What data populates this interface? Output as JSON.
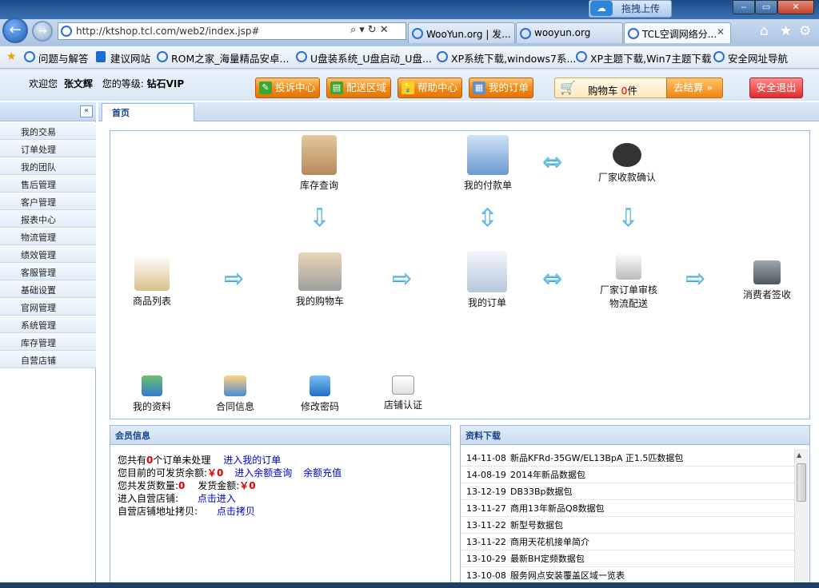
{
  "browser": {
    "upload_label": "拖拽上传",
    "upload_icon": "cloud-icon",
    "address": "http://ktshop.tcl.com/web2/index.jsp#",
    "tabs": [
      {
        "label": "WooYun.org | 发..."
      },
      {
        "label": "wooyun.org"
      },
      {
        "label": "TCL空调网络分...",
        "active": true
      }
    ],
    "favorites": [
      {
        "label": "问题与解答",
        "icon": "star-icon"
      },
      {
        "label": "建议网站",
        "icon": "bing-icon"
      },
      {
        "label": "ROM之家_海量精品安卓...",
        "icon": "ie-icon"
      },
      {
        "label": "U盘装系统_U盘启动_U盘...",
        "icon": "ie-icon"
      },
      {
        "label": "XP系统下载,windows7系...",
        "icon": "ie-icon"
      },
      {
        "label": "XP主题下载,Win7主题下载",
        "icon": "ie-icon"
      },
      {
        "label": "安全网址导航",
        "icon": "ie-icon"
      }
    ]
  },
  "header": {
    "welcome_prefix": "欢迎您",
    "username": "张文辉",
    "level_prefix": "您的等级:",
    "level": "钻石VIP",
    "buttons": [
      {
        "label": "投诉中心"
      },
      {
        "label": "配送区域"
      },
      {
        "label": "帮助中心"
      },
      {
        "label": "我的订单"
      }
    ],
    "cart_label": "购物车",
    "cart_count": "0",
    "cart_unit": "件",
    "checkout_label": "去结算 »",
    "logout_label": "安全退出"
  },
  "sidebar": {
    "collapse_icon": "double-chevron-left-icon",
    "items": [
      "我的交易",
      "订单处理",
      "我的团队",
      "售后管理",
      "客户管理",
      "报表中心",
      "物流管理",
      "绩效管理",
      "客服管理",
      "基础设置",
      "官网管理",
      "系统管理",
      "库存管理",
      "自营店铺"
    ]
  },
  "main": {
    "tab": "首页",
    "flow": {
      "stock": "库存查询",
      "payment": "我的付款单",
      "confirm": "厂家收款确认",
      "products": "商品列表",
      "cart": "我的购物车",
      "orders": "我的订单",
      "audit_1": "厂家订单审核",
      "audit_2": "物流配送",
      "signoff": "消费者签收",
      "profile": "我的资料",
      "contract": "合同信息",
      "password": "修改密码",
      "store_cert": "店铺认证"
    },
    "member": {
      "title": "会员信息",
      "pending_prefix": "您共有",
      "pending_count": "0",
      "pending_suffix": "个订单未处理",
      "pending_link": "进入我的订单",
      "balance_label": "您目前的可发货余额:",
      "balance_value": "￥0",
      "balance_link": "进入余额查询",
      "recharge_link": "余额充值",
      "ship_qty_label": "您共发货数量:",
      "ship_qty_value": "0",
      "ship_amt_label": "发货金额:",
      "ship_amt_value": "￥0",
      "store_label": "进入自营店铺:",
      "store_link": "点击进入",
      "store_addr_label": "自营店铺地址拷贝:",
      "store_addr_link": "点击拷贝"
    },
    "downloads": {
      "title": "资料下载",
      "rows": [
        {
          "date": "14-11-08",
          "name": "新品KFRd-35GW/EL13BpA 正1.5匹数据包"
        },
        {
          "date": "14-08-19",
          "name": "2014年新品数据包"
        },
        {
          "date": "13-12-19",
          "name": "DB33Bp数据包"
        },
        {
          "date": "13-11-27",
          "name": "商用13年新品Q8数据包"
        },
        {
          "date": "13-11-22",
          "name": "新型号数据包"
        },
        {
          "date": "13-11-22",
          "name": "商用天花机接单简介"
        },
        {
          "date": "13-10-29",
          "name": "最新BH定频数据包"
        },
        {
          "date": "13-10-08",
          "name": "服务网点安装覆盖区域一览表"
        }
      ]
    }
  }
}
